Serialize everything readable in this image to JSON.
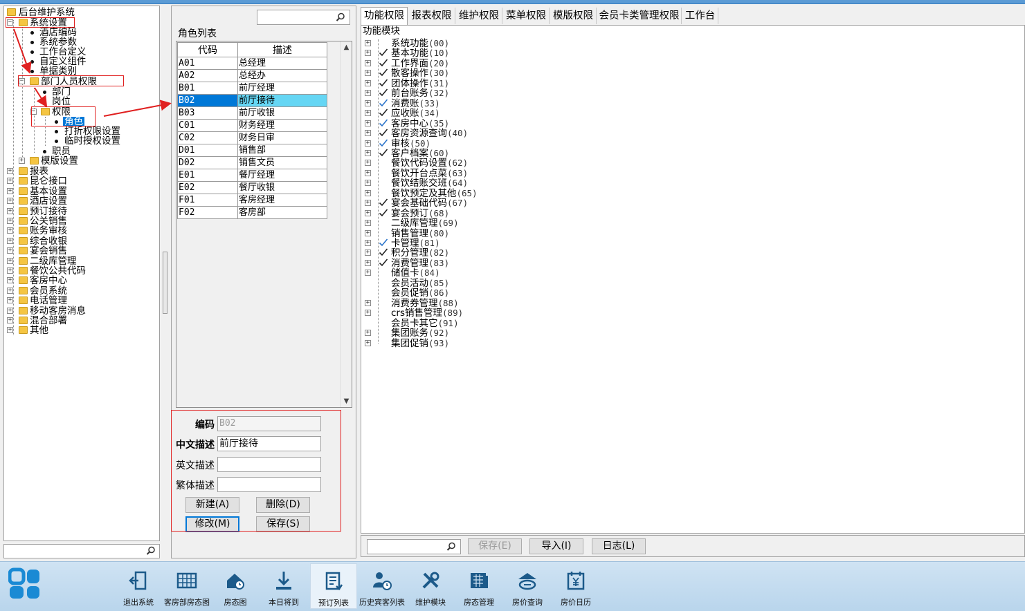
{
  "left_tree": {
    "root": "后台维护系统",
    "system_settings": "系统设置",
    "hotel_code": "酒店编码",
    "system_params": "系统参数",
    "workstation_def": "工作台定义",
    "custom_components": "自定义组件",
    "document_category": "单据类别",
    "dept_staff_perm": "部门人员权限",
    "department": "部门",
    "position": "岗位",
    "permission": "权限",
    "role": "角色",
    "discount_perm": "打折权限设置",
    "temp_auth": "临时授权设置",
    "staff": "职员",
    "template_settings": "模版设置",
    "top_items": [
      "报表",
      "昆仑接口",
      "基本设置",
      "酒店设置",
      "预订接待",
      "公关销售",
      "账务审核",
      "综合收银",
      "宴会销售",
      "二级库管理",
      "餐饮公共代码",
      "客房中心",
      "会员系统",
      "电话管理",
      "移动客房消息",
      "混合部署",
      "其他"
    ]
  },
  "roles": {
    "title": "角色列表",
    "col_code": "代码",
    "col_desc": "描述",
    "rows": [
      {
        "code": "A01",
        "desc": "总经理"
      },
      {
        "code": "A02",
        "desc": "总经办"
      },
      {
        "code": "B01",
        "desc": "前厅经理"
      },
      {
        "code": "B02",
        "desc": "前厅接待"
      },
      {
        "code": "B03",
        "desc": "前厅收银"
      },
      {
        "code": "C01",
        "desc": "财务经理"
      },
      {
        "code": "C02",
        "desc": "财务日审"
      },
      {
        "code": "D01",
        "desc": "销售部"
      },
      {
        "code": "D02",
        "desc": "销售文员"
      },
      {
        "code": "E01",
        "desc": "餐厅经理"
      },
      {
        "code": "E02",
        "desc": "餐厅收银"
      },
      {
        "code": "F01",
        "desc": "客房经理"
      },
      {
        "code": "F02",
        "desc": "客房部"
      }
    ],
    "selected": "B02"
  },
  "edit": {
    "code_label": "编码",
    "code_value": "B02",
    "cn_label": "中文描述",
    "cn_value": "前厅接待",
    "en_label": "英文描述",
    "en_value": "",
    "tw_label": "繁体描述",
    "tw_value": "",
    "new_btn": "新建(A)",
    "delete_btn": "删除(D)",
    "modify_btn": "修改(M)",
    "save_btn": "保存(S)"
  },
  "tabs": [
    "功能权限",
    "报表权限",
    "维护权限",
    "菜单权限",
    "模版权限",
    "会员卡类管理权限",
    "工作台"
  ],
  "func_panel": {
    "title": "功能模块",
    "items": [
      {
        "name": "系统功能",
        "code": "(00)",
        "check": "none",
        "exp": true
      },
      {
        "name": "基本功能",
        "code": "(10)",
        "check": "black",
        "exp": true
      },
      {
        "name": "工作界面",
        "code": "(20)",
        "check": "black",
        "exp": true
      },
      {
        "name": "散客操作",
        "code": "(30)",
        "check": "black",
        "exp": true
      },
      {
        "name": "团体操作",
        "code": "(31)",
        "check": "black",
        "exp": true
      },
      {
        "name": "前台账务",
        "code": "(32)",
        "check": "black",
        "exp": true
      },
      {
        "name": "消费账",
        "code": "(33)",
        "check": "blue",
        "exp": true
      },
      {
        "name": "应收账",
        "code": "(34)",
        "check": "black",
        "exp": true
      },
      {
        "name": "客房中心",
        "code": "(35)",
        "check": "blue",
        "exp": true
      },
      {
        "name": "客房资源查询",
        "code": "(40)",
        "check": "black",
        "exp": true
      },
      {
        "name": "审核",
        "code": "(50)",
        "check": "blue",
        "exp": true
      },
      {
        "name": "客户档案",
        "code": "(60)",
        "check": "black",
        "exp": true
      },
      {
        "name": "餐饮代码设置",
        "code": "(62)",
        "check": "none",
        "exp": true
      },
      {
        "name": "餐饮开台点菜",
        "code": "(63)",
        "check": "none",
        "exp": true
      },
      {
        "name": "餐饮结账交班",
        "code": "(64)",
        "check": "none",
        "exp": true
      },
      {
        "name": "餐饮预定及其他",
        "code": "(65)",
        "check": "none",
        "exp": true
      },
      {
        "name": "宴会基础代码",
        "code": "(67)",
        "check": "black",
        "exp": true
      },
      {
        "name": "宴会预订",
        "code": "(68)",
        "check": "black",
        "exp": true
      },
      {
        "name": "二级库管理",
        "code": "(69)",
        "check": "none",
        "exp": true
      },
      {
        "name": "销售管理",
        "code": "(80)",
        "check": "none",
        "exp": true
      },
      {
        "name": "卡管理",
        "code": "(81)",
        "check": "blue",
        "exp": true
      },
      {
        "name": "积分管理",
        "code": "(82)",
        "check": "black",
        "exp": true
      },
      {
        "name": "消费管理",
        "code": "(83)",
        "check": "black",
        "exp": true
      },
      {
        "name": "储值卡",
        "code": "(84)",
        "check": "none",
        "exp": true
      },
      {
        "name": "会员活动",
        "code": "(85)",
        "check": "none",
        "exp": false
      },
      {
        "name": "会员促销",
        "code": "(86)",
        "check": "none",
        "exp": false
      },
      {
        "name": "消费券管理",
        "code": "(88)",
        "check": "none",
        "exp": true
      },
      {
        "name": "crs销售管理",
        "code": "(89)",
        "check": "none",
        "exp": true
      },
      {
        "name": "会员卡其它",
        "code": "(91)",
        "check": "none",
        "exp": false
      },
      {
        "name": "集团账务",
        "code": "(92)",
        "check": "none",
        "exp": true
      },
      {
        "name": "集团促销",
        "code": "(93)",
        "check": "none",
        "exp": true
      }
    ]
  },
  "bottom_bar": {
    "save_btn": "保存(E)",
    "import_btn": "导入(I)",
    "log_btn": "日志(L)"
  },
  "taskbar": [
    {
      "label": "退出系统",
      "icon": "exit-icon"
    },
    {
      "label": "客房部房态图",
      "icon": "room-status-grid-icon"
    },
    {
      "label": "房态图",
      "icon": "house-icon"
    },
    {
      "label": "本日将到",
      "icon": "arrival-icon"
    },
    {
      "label": "预订列表",
      "icon": "reservation-list-icon"
    },
    {
      "label": "历史宾客列表",
      "icon": "guest-history-icon"
    },
    {
      "label": "维护模块",
      "icon": "tools-icon"
    },
    {
      "label": "房态管理",
      "icon": "room-management-icon"
    },
    {
      "label": "房价查询",
      "icon": "rate-query-icon"
    },
    {
      "label": "房价日历",
      "icon": "rate-calendar-icon"
    }
  ],
  "colors": {
    "selection": "#0078d7",
    "row_highlight": "#65d6f4",
    "annotation": "#e02020",
    "taskbar": "#c3dcf0"
  }
}
